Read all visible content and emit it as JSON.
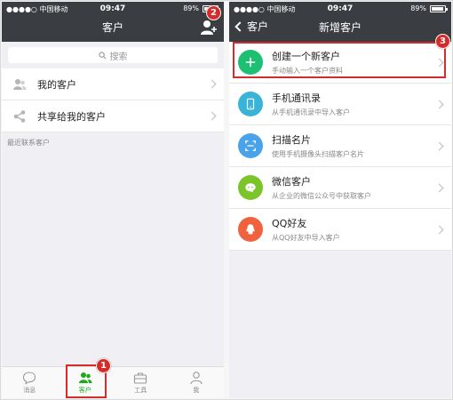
{
  "status": {
    "carrier": "●●●●○ 中国移动",
    "time": "09:47",
    "battery": "89%"
  },
  "screen1": {
    "title": "客户",
    "search_placeholder": "搜索",
    "menu": [
      {
        "label": "我的客户",
        "icon": "customers-icon"
      },
      {
        "label": "共享给我的客户",
        "icon": "share-icon"
      }
    ],
    "section_label": "最近联系客户",
    "tabs": [
      {
        "label": "消息",
        "icon": "message-icon"
      },
      {
        "label": "客户",
        "icon": "customers-icon",
        "active": true
      },
      {
        "label": "工具",
        "icon": "toolbox-icon"
      },
      {
        "label": "我",
        "icon": "profile-icon"
      }
    ],
    "badges": {
      "tab_customers": "1",
      "add_button": "2"
    }
  },
  "screen2": {
    "back_label": "客户",
    "title": "新增客户",
    "options": [
      {
        "title": "创建一个新客户",
        "subtitle": "手动输入一个客户资料",
        "icon": "plus-icon",
        "color": "#1dbf73"
      },
      {
        "title": "手机通讯录",
        "subtitle": "从手机通讯录中导入客户",
        "icon": "phone-icon",
        "color": "#3ab3d8"
      },
      {
        "title": "扫描名片",
        "subtitle": "使用手机摄像头扫描客户名片",
        "icon": "scan-icon",
        "color": "#4aa3e8"
      },
      {
        "title": "微信客户",
        "subtitle": "从企业的微信公众号中获取客户",
        "icon": "wechat-icon",
        "color": "#7bc42a"
      },
      {
        "title": "QQ好友",
        "subtitle": "从QQ好友中导入客户",
        "icon": "qq-icon",
        "color": "#f0613d"
      }
    ],
    "badge": "3"
  },
  "colors": {
    "navbar": "#3a3d42",
    "accent": "#1aad19",
    "highlight": "#d42b2b"
  }
}
